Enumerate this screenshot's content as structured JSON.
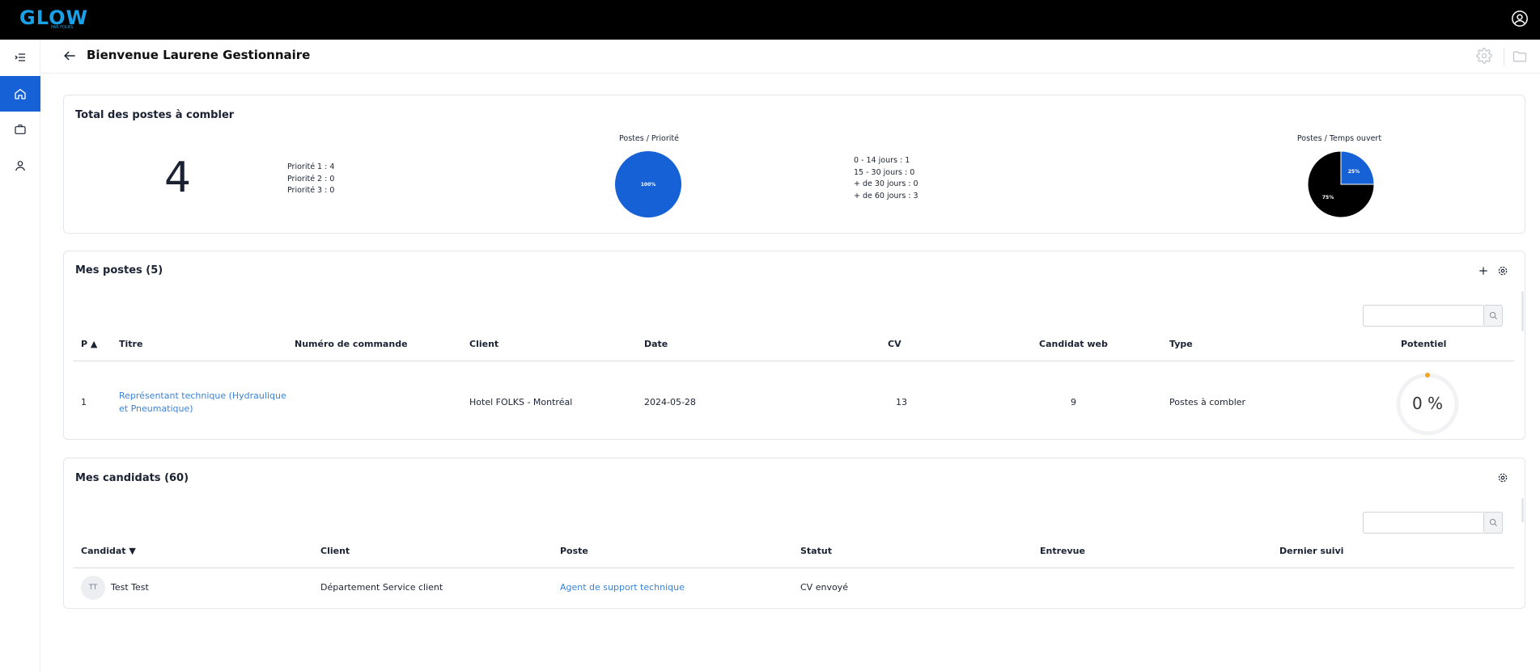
{
  "app": {
    "logo": "GLOW",
    "logo_sub": "PAR FOLKS"
  },
  "header": {
    "title": "Bienvenue Laurene Gestionnaire"
  },
  "sidebar": {
    "items": [
      {
        "icon": "menu-collapse-icon"
      },
      {
        "icon": "home-icon",
        "active": true
      },
      {
        "icon": "briefcase-icon"
      },
      {
        "icon": "person-icon"
      }
    ]
  },
  "summary": {
    "title": "Total des postes à combler",
    "total": "4",
    "priorities": [
      "Priorité 1 : 4",
      "Priorité 2 : 0",
      "Priorité 3 : 0"
    ],
    "priority_chart_title": "Postes / Priorité",
    "durations": [
      "0 - 14 jours : 1",
      "15 - 30 jours : 0",
      "+ de 30 jours : 0",
      "+ de 60 jours : 3"
    ],
    "time_chart_title": "Postes / Temps ouvert"
  },
  "chart_data": [
    {
      "type": "pie",
      "title": "Postes / Priorité",
      "labels": [
        "Priorité 1"
      ],
      "values": [
        100
      ],
      "data_labels": [
        "100%"
      ],
      "colors": [
        "#1761d6"
      ]
    },
    {
      "type": "pie",
      "title": "Postes / Temps ouvert",
      "labels": [
        "0 - 14 jours",
        "+ de 60 jours"
      ],
      "values": [
        25,
        75
      ],
      "data_labels": [
        "25%",
        "75%"
      ],
      "colors": [
        "#1761d6",
        "#000000"
      ]
    }
  ],
  "postes": {
    "title": "Mes postes (5)",
    "columns": [
      "P ▲",
      "Titre",
      "Numéro de commande",
      "Client",
      "Date",
      "CV",
      "Candidat web",
      "Type",
      "Potentiel"
    ],
    "rows": [
      {
        "p": "1",
        "titre_line1": "Représentant technique (Hydraulique",
        "titre_line2": "et Pneumatique)",
        "numero": "",
        "client": "Hotel FOLKS - Montréal",
        "date": "2024-05-28",
        "cv": "13",
        "web": "9",
        "type": "Postes à combler",
        "potentiel": "0 %",
        "potentiel_value": 0
      }
    ]
  },
  "candidats": {
    "title": "Mes candidats (60)",
    "columns": [
      "Candidat ▼",
      "Client",
      "Poste",
      "Statut",
      "Entrevue",
      "Dernier suivi"
    ],
    "rows": [
      {
        "initials": "TT",
        "name": "Test Test",
        "client": "Département Service client",
        "poste": "Agent de support technique",
        "statut": "CV envoyé",
        "entrevue": "",
        "suivi": ""
      }
    ]
  },
  "colors": {
    "accent": "#1761d6",
    "link": "#3b82d6",
    "topbar": "#000000",
    "potentiel_dot": "#f5a623"
  }
}
